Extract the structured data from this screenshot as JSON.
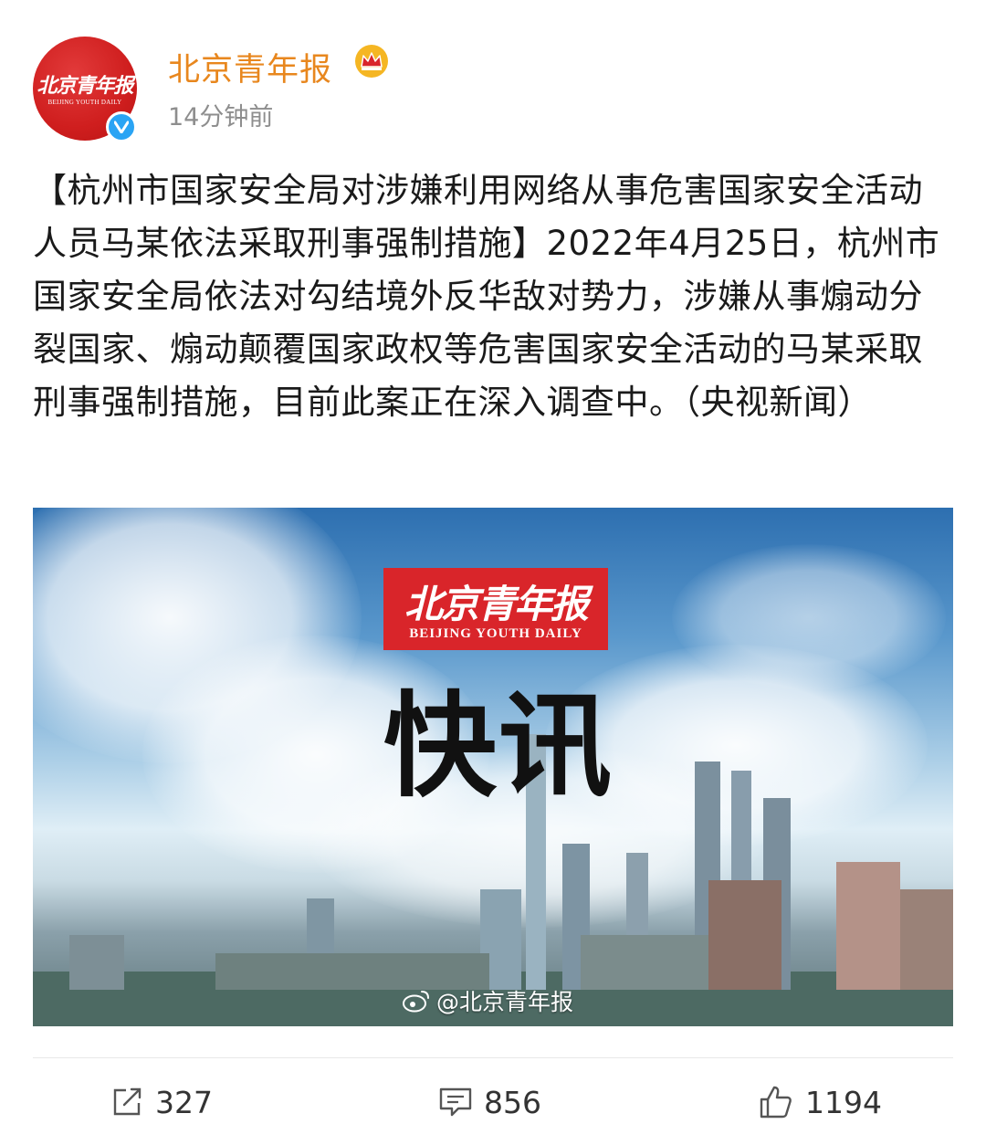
{
  "post": {
    "author": "北京青年报",
    "time": "14分钟前",
    "avatar_logo": "北京青年报",
    "avatar_logo_en": "BEIJING YOUTH DAILY",
    "text": "【杭州市国家安全局对涉嫌利用网络从事危害国家安全活动人员马某依法采取刑事强制措施】2022年4月25日，杭州市国家安全局依法对勾结境外反华敌对势力，涉嫌从事煽动分裂国家、煽动颠覆国家政权等危害国家安全活动的马某采取刑事强制措施，目前此案正在深入调查中。（央视新闻）"
  },
  "image": {
    "brand_cn": "北京青年报",
    "brand_en": "BEIJING YOUTH DAILY",
    "headline": "快讯",
    "watermark": "@北京青年报"
  },
  "actions": {
    "repost_count": "327",
    "comment_count": "856",
    "like_count": "1194"
  },
  "colors": {
    "author": "#e8871e",
    "brand_red": "#d9252a",
    "verified": "#2aa4f4"
  }
}
